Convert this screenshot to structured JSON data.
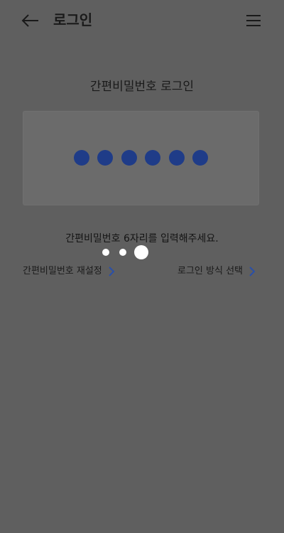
{
  "header": {
    "title": "로그인",
    "back_icon": "arrow-left-icon",
    "menu_icon": "hamburger-menu-icon"
  },
  "main": {
    "section_title": "간편비밀번호 로그인",
    "pin_length": 6,
    "pin_filled": 6,
    "instruction": "간편비밀번호 6자리를 입력해주세요.",
    "links": {
      "reset_label": "간편비밀번호 재설정",
      "method_label": "로그인 방식 선택"
    }
  },
  "colors": {
    "pin_dot": "#1f3c88",
    "chevron": "#2a4fa8",
    "overlay_bg": "#5f5f5f"
  }
}
